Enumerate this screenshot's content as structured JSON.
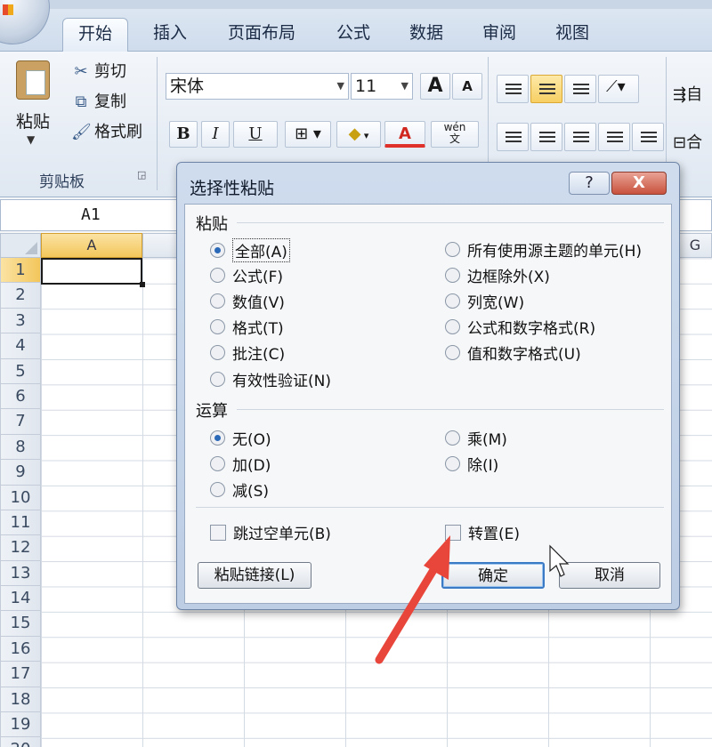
{
  "ribbon": {
    "tabs": [
      "开始",
      "插入",
      "页面布局",
      "公式",
      "数据",
      "审阅",
      "视图"
    ],
    "active_tab": "开始",
    "clipboard": {
      "paste_label": "粘贴",
      "cut_label": "剪切",
      "copy_label": "复制",
      "format_painter_label": "格式刷",
      "group_label": "剪贴板"
    },
    "font": {
      "font_name": "宋体",
      "font_size": "11",
      "grow_label": "A",
      "shrink_label": "A",
      "bold_label": "B",
      "italic_label": "I",
      "underline_label": "U",
      "color_label": "A",
      "phonetic_label": "wén\n文"
    },
    "edge_text_1": "自",
    "edge_text_2": "合"
  },
  "sheet": {
    "name_box": "A1",
    "columns": [
      "A",
      "G"
    ],
    "rows": [
      "1",
      "2",
      "3",
      "4",
      "5",
      "6",
      "7",
      "8",
      "9",
      "10",
      "11",
      "12",
      "13",
      "14",
      "15",
      "16",
      "17",
      "18",
      "19",
      "20"
    ]
  },
  "dialog": {
    "title": "选择性粘贴",
    "help_label": "?",
    "close_label": "X",
    "paste_section": "粘贴",
    "paste_options_left": [
      {
        "label": "全部(A)",
        "checked": true
      },
      {
        "label": "公式(F)",
        "checked": false
      },
      {
        "label": "数值(V)",
        "checked": false
      },
      {
        "label": "格式(T)",
        "checked": false
      },
      {
        "label": "批注(C)",
        "checked": false
      },
      {
        "label": "有效性验证(N)",
        "checked": false
      }
    ],
    "paste_options_right": [
      {
        "label": "所有使用源主题的单元(H)"
      },
      {
        "label": "边框除外(X)"
      },
      {
        "label": "列宽(W)"
      },
      {
        "label": "公式和数字格式(R)"
      },
      {
        "label": "值和数字格式(U)"
      }
    ],
    "operation_section": "运算",
    "operation_left": [
      {
        "label": "无(O)",
        "checked": true
      },
      {
        "label": "加(D)",
        "checked": false
      },
      {
        "label": "减(S)",
        "checked": false
      }
    ],
    "operation_right": [
      {
        "label": "乘(M)"
      },
      {
        "label": "除(I)"
      }
    ],
    "skip_blanks_label": "跳过空单元(B)",
    "transpose_label": "转置(E)",
    "paste_link_label": "粘贴链接(L)",
    "ok_label": "确定",
    "cancel_label": "取消"
  },
  "annotation": {
    "arrow_color": "#e8463a"
  }
}
